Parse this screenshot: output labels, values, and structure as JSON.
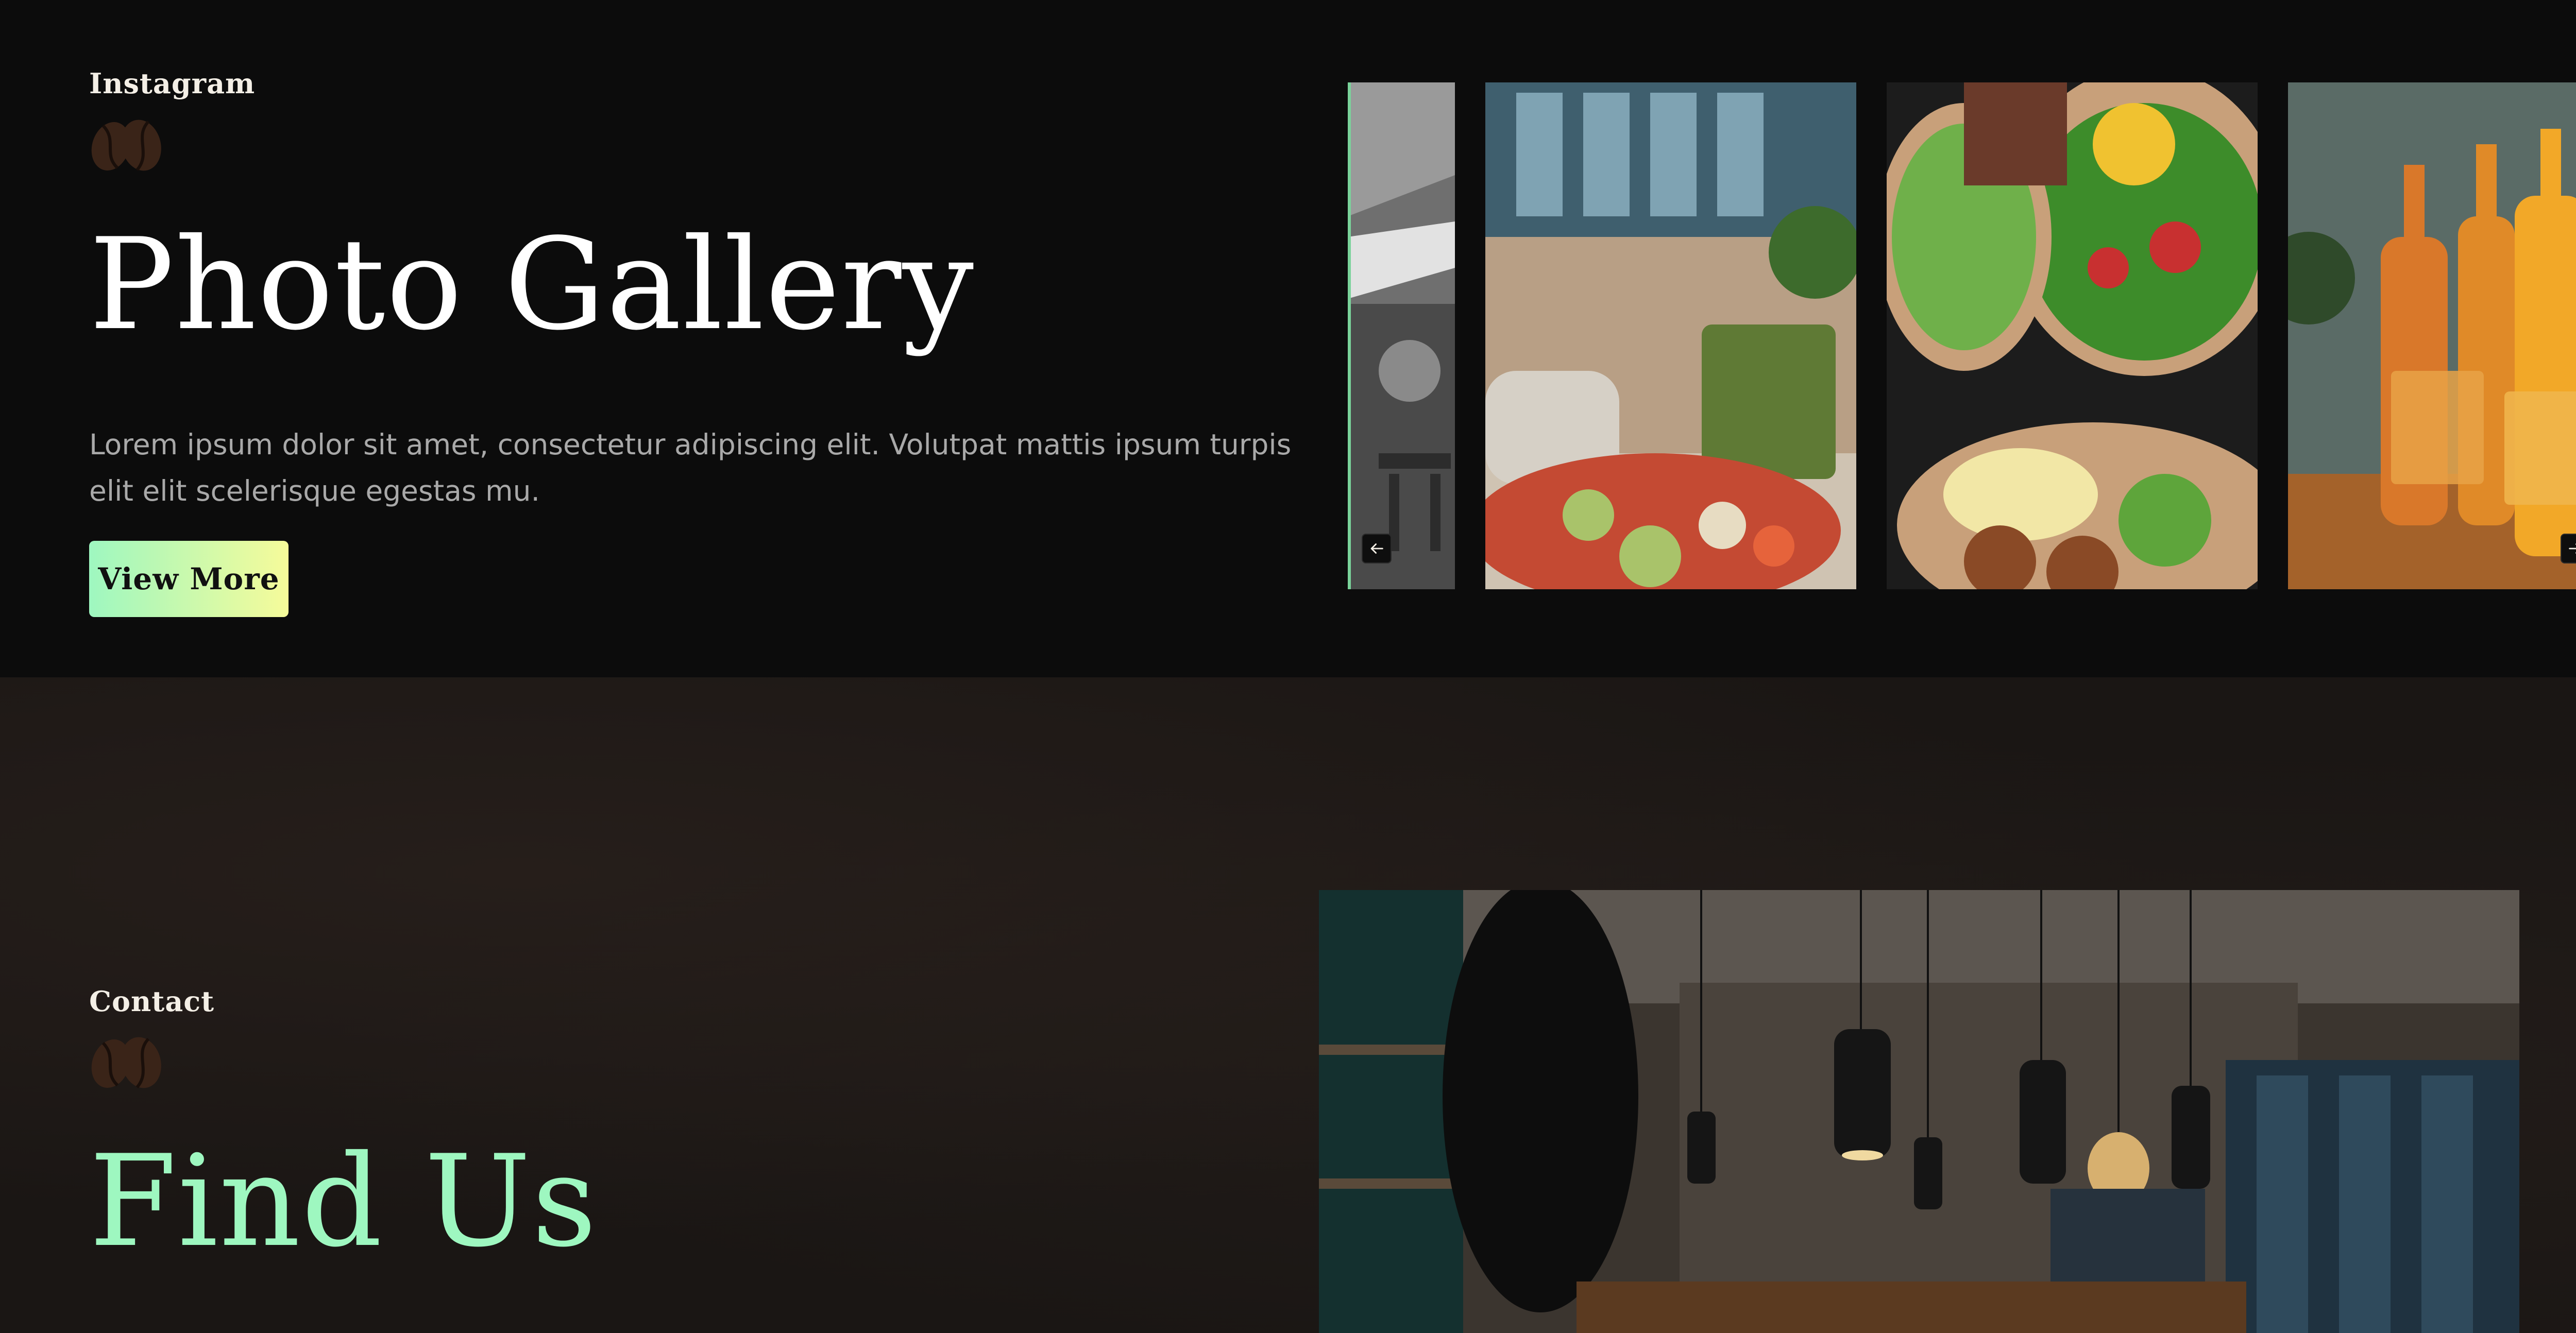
{
  "gallery": {
    "eyebrow": "Instagram",
    "title": "Photo Gallery",
    "description": "Lorem ipsum dolor sit amet, consectetur adipiscing elit. Volutpat mattis ipsum turpis elit elit scelerisque egestas mu.",
    "button_label": "View More",
    "slides": [
      {
        "subject": "outdoor terrace with umbrella (black & white)"
      },
      {
        "subject": "green smoothie and fruit salad at window"
      },
      {
        "subject": "salad bowls with peas and mango"
      },
      {
        "subject": "bottles of homemade juices"
      }
    ],
    "prev_icon": "arrow-left-icon",
    "next_icon": "arrow-right-icon"
  },
  "contact": {
    "eyebrow": "Contact",
    "title": "Find Us",
    "photo_subject": "cafe interior with pendant lamps"
  },
  "colors": {
    "background": "#0c0c0c",
    "contact_background": "#1a1614",
    "accent_green": "#9ef7c0",
    "accent_yellow": "#f6fb9a",
    "text_muted": "#a9a9a9",
    "bean_icon": "#3a2418"
  }
}
